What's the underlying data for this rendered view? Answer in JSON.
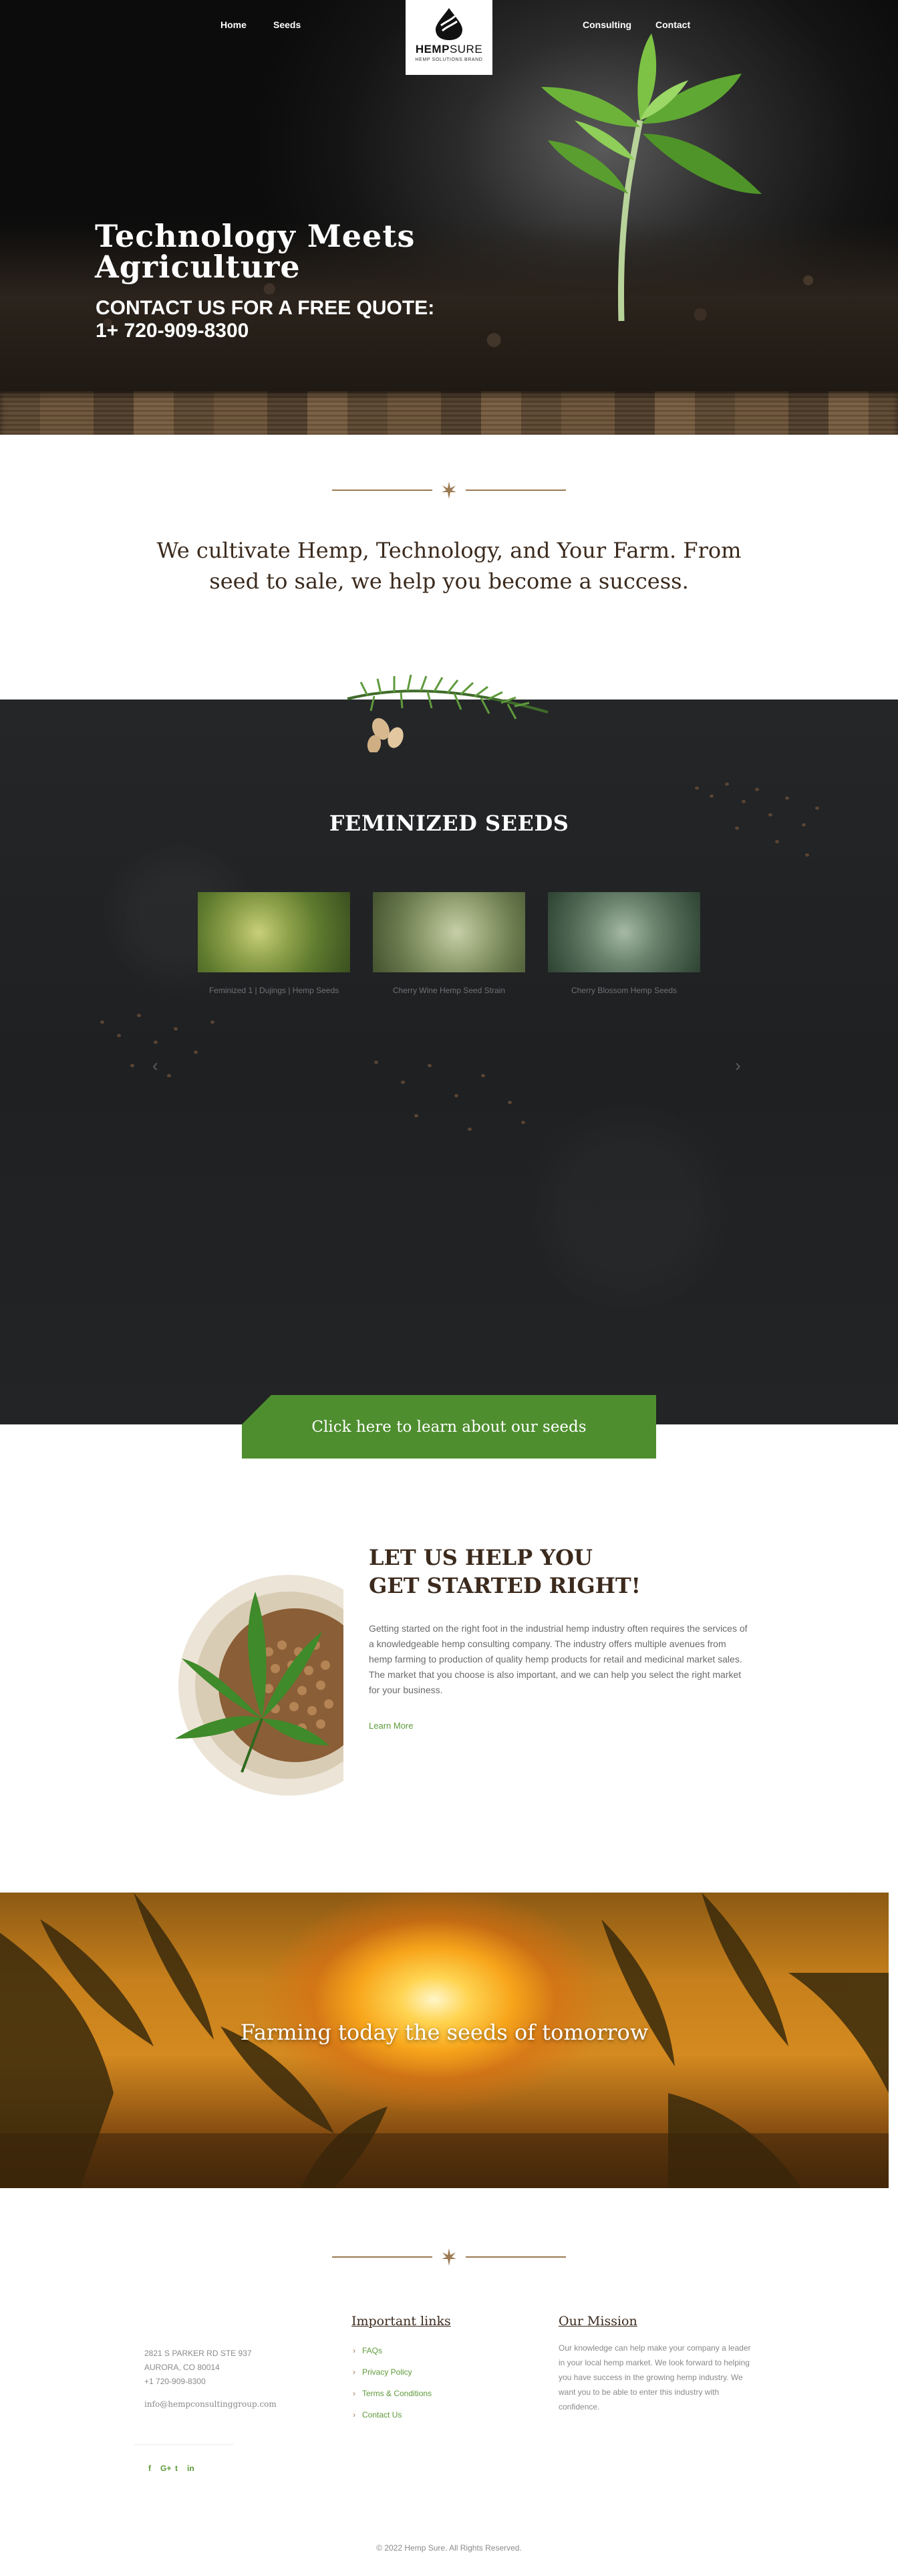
{
  "nav": {
    "home": "Home",
    "seeds": "Seeds",
    "consulting": "Consulting",
    "contact": "Contact",
    "logo_text_bold": "HEMP",
    "logo_text": "SURE",
    "logo_tagline": "HEMP SOLUTIONS BRAND"
  },
  "hero": {
    "title": "Technology Meets Agriculture",
    "cta_line1": "CONTACT US FOR A FREE QUOTE:",
    "cta_line2": "1+ 720-909-8300"
  },
  "intro": {
    "text": "We cultivate Hemp, Technology, and Your Farm. From seed to sale, we help you become a success."
  },
  "seeds": {
    "title": "FEMINIZED SEEDS",
    "products": [
      {
        "caption": "Feminized 1 | Dujings | Hemp Seeds"
      },
      {
        "caption": "Cherry Wine Hemp Seed Strain"
      },
      {
        "caption": "Cherry Blossom Hemp Seeds"
      }
    ],
    "prev_icon": "chevron-left-icon",
    "next_icon": "chevron-right-icon",
    "cta": "Click here to learn about our seeds"
  },
  "help": {
    "title": "LET US HELP YOU GET STARTED RIGHT!",
    "body": "Getting started on the right foot in the industrial hemp industry often requires the services of a knowledgeable hemp consulting company. The industry offers multiple avenues from hemp farming to production of quality hemp products for retail and medicinal market sales. The market that you choose is also important, and we can help you select the right market for your business.",
    "learn_more": "Learn More"
  },
  "banner": {
    "text": "Farming today the seeds of tomorrow"
  },
  "footer": {
    "address1": "2821 S PARKER RD STE 937",
    "address2": "AURORA, CO 80014",
    "phone": "+1 720-909-8300",
    "email": "info@hempconsultinggroup.com",
    "links_heading": "Important links",
    "links": [
      "FAQs",
      "Privacy Policy",
      "Terms & Conditions",
      "Contact Us"
    ],
    "mission_heading": "Our Mission",
    "mission_text": "Our knowledge can help make your company a leader in your local hemp market. We look forward to helping you have success in the growing hemp industry. We want you to be able to enter this industry with confidence.",
    "social": {
      "facebook": "f",
      "google": "G+",
      "twitter": "t",
      "linkedin": "in"
    },
    "copyright": "© 2022 Hemp Sure. All Rights Reserved."
  },
  "colors": {
    "accent_green": "#4e8e2f",
    "link_green": "#5e9a3a",
    "brown_text": "#3b2a1d",
    "divider_brown": "#9c7a52",
    "seeds_bg": "#222425"
  }
}
